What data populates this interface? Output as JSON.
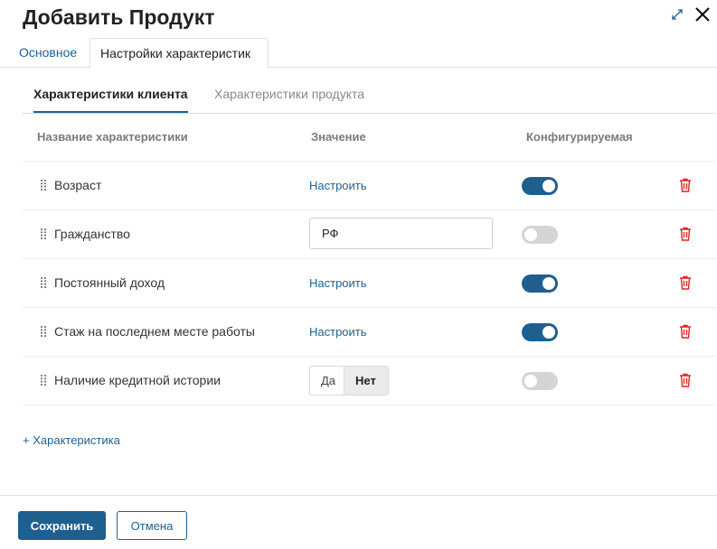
{
  "dialog": {
    "title": "Добавить Продукт",
    "icons": {
      "expand": "expand-arrows-icon",
      "close": "close-x-icon"
    }
  },
  "main_tabs": [
    {
      "label": "Основное",
      "active": false
    },
    {
      "label": "Настройки характеристик",
      "active": true
    }
  ],
  "sub_tabs": [
    {
      "label": "Характеристики клиента",
      "active": true
    },
    {
      "label": "Характеристики продукта",
      "active": false
    }
  ],
  "table": {
    "headers": {
      "name": "Название характеристики",
      "value": "Значение",
      "configurable": "Конфигурируемая"
    },
    "rows": [
      {
        "label": "Возраст",
        "value_type": "link",
        "value": "Настроить",
        "configurable": true
      },
      {
        "label": "Гражданство",
        "value_type": "input",
        "value": "РФ",
        "configurable": false
      },
      {
        "label": "Постоянный доход",
        "value_type": "link",
        "value": "Настроить",
        "configurable": true
      },
      {
        "label": "Стаж на последнем месте работы",
        "value_type": "link",
        "value": "Настроить",
        "configurable": true
      },
      {
        "label": "Наличие кредитной истории",
        "value_type": "yesno",
        "yes": "Да",
        "no": "Нет",
        "selected": "Нет",
        "configurable": false
      }
    ]
  },
  "add_characteristic_label": "+ Характеристика",
  "footer": {
    "save_label": "Сохранить",
    "cancel_label": "Отмена"
  },
  "colors": {
    "accent": "#1f5f8f",
    "delete": "#e02424",
    "toggle_off": "#d4d4d4"
  }
}
